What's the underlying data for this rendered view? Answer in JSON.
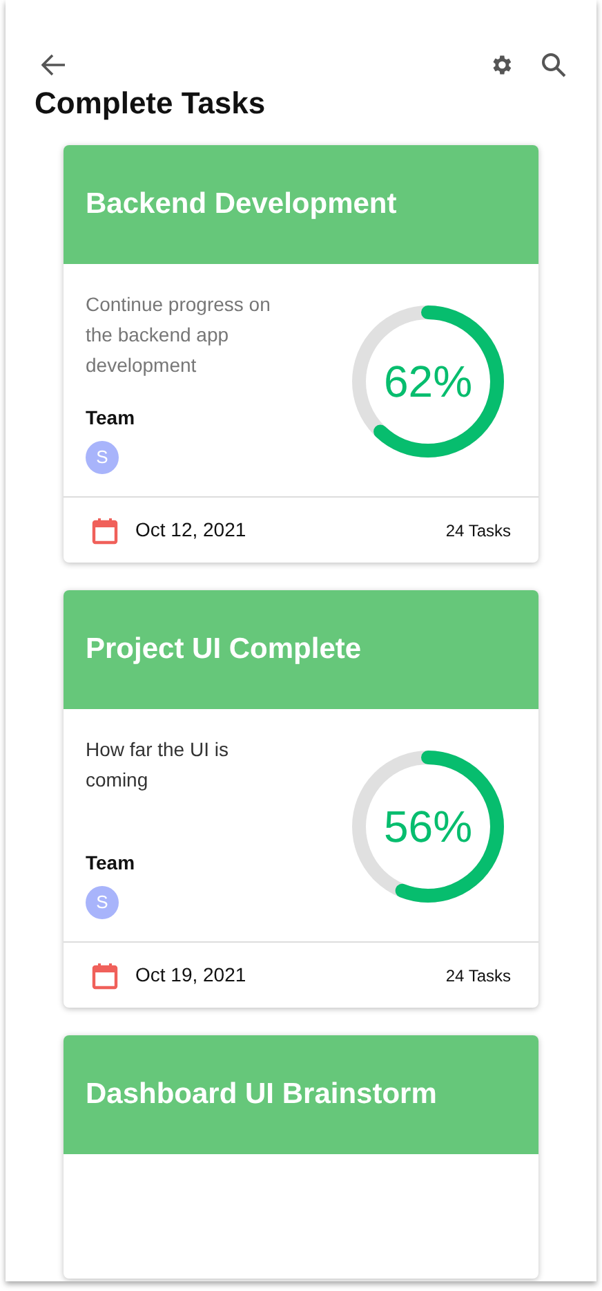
{
  "header": {
    "title": "Complete Tasks"
  },
  "cards": [
    {
      "title": "Backend Development",
      "description": "Continue progress on the backend app development",
      "team_label": "Team",
      "members": [
        {
          "initial": "S",
          "color": "#a8b4fb"
        }
      ],
      "level": 0.62,
      "percent": "62%",
      "date": "Oct 12, 2021",
      "tasks": "24 Tasks"
    },
    {
      "title": "Project UI Complete",
      "description": "How far the UI is coming",
      "team_label": "Team",
      "members": [
        {
          "initial": "S",
          "color": "#a8b4fb"
        }
      ],
      "level": 0.56,
      "percent": "56%",
      "date": "Oct 19, 2021",
      "tasks": "24 Tasks"
    },
    {
      "title": "Dashboard UI Brainstorm"
    }
  ]
}
